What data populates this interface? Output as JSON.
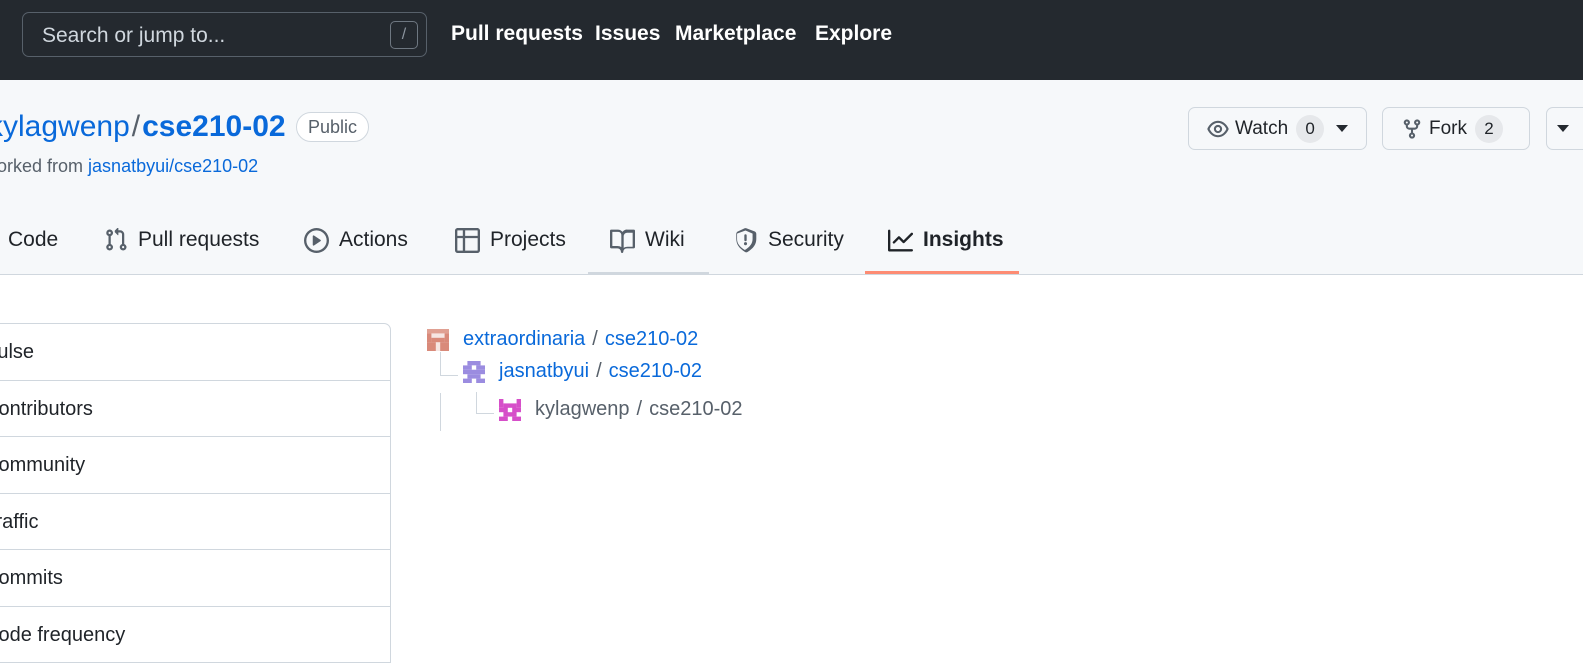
{
  "topbar": {
    "search_placeholder": "Search or jump to...",
    "search_shortcut": "/",
    "links": [
      "Pull requests",
      "Issues",
      "Marketplace",
      "Explore"
    ]
  },
  "repo": {
    "owner": "kylagwenp",
    "separator": "/",
    "name": "cse210-02",
    "visibility": "Public",
    "forked_prefix": "forked from",
    "forked_from": "jasnatbyui/cse210-02"
  },
  "actions": {
    "watch_label": "Watch",
    "watch_count": "0",
    "fork_label": "Fork",
    "fork_count": "2"
  },
  "tabs": [
    {
      "label": "Code",
      "icon": "code-icon"
    },
    {
      "label": "Pull requests",
      "icon": "git-pull-request-icon"
    },
    {
      "label": "Actions",
      "icon": "play-icon"
    },
    {
      "label": "Projects",
      "icon": "table-icon"
    },
    {
      "label": "Wiki",
      "icon": "book-icon"
    },
    {
      "label": "Security",
      "icon": "shield-icon"
    },
    {
      "label": "Insights",
      "icon": "graph-icon",
      "active": true
    }
  ],
  "sidebar": {
    "items": [
      "Pulse",
      "Contributors",
      "Community",
      "Traffic",
      "Commits",
      "Code frequency"
    ]
  },
  "network": {
    "nodes": [
      {
        "owner": "extraordinaria",
        "repo": "cse210-02"
      },
      {
        "owner": "jasnatbyui",
        "repo": "cse210-02"
      },
      {
        "owner": "kylagwenp",
        "repo": "cse210-02",
        "current": true
      }
    ],
    "separator": "/"
  },
  "colors": {
    "header_bg": "#24292f",
    "link": "#0969da",
    "active_tab_underline": "#fd8c73"
  }
}
